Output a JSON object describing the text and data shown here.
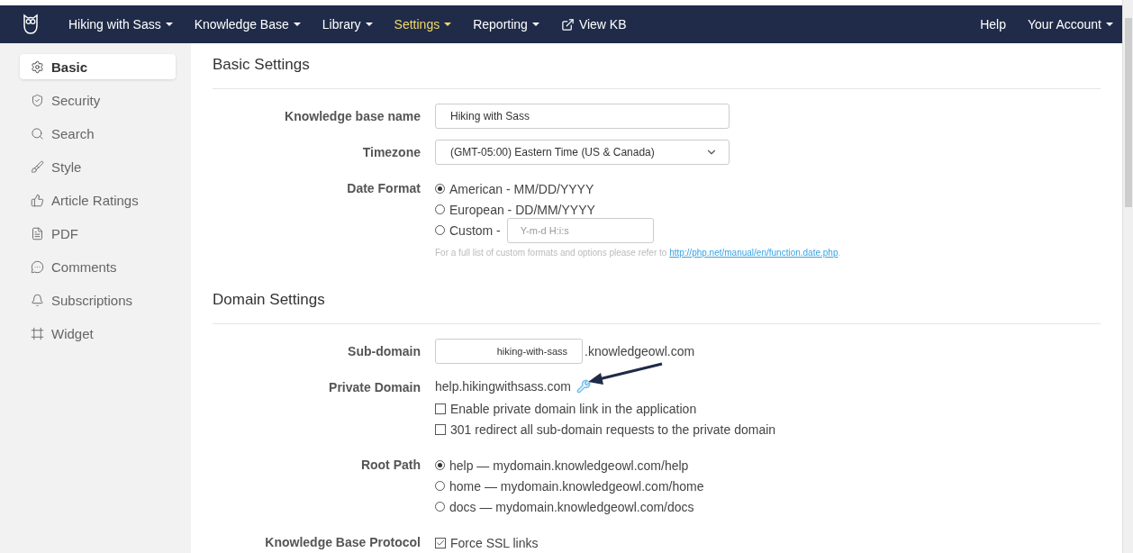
{
  "nav": {
    "items": [
      {
        "label": "Hiking with Sass",
        "dropdown": true,
        "selected": false,
        "kind": "menu"
      },
      {
        "label": "Knowledge Base",
        "dropdown": true,
        "selected": false,
        "kind": "menu"
      },
      {
        "label": "Library",
        "dropdown": true,
        "selected": false,
        "kind": "menu"
      },
      {
        "label": "Settings",
        "dropdown": true,
        "selected": true,
        "kind": "menu"
      },
      {
        "label": "Reporting",
        "dropdown": true,
        "selected": false,
        "kind": "menu"
      },
      {
        "label": "View KB",
        "dropdown": false,
        "selected": false,
        "kind": "external"
      }
    ],
    "right": [
      {
        "label": "Help",
        "dropdown": false
      },
      {
        "label": "Your Account",
        "dropdown": true
      }
    ]
  },
  "sidebar": {
    "items": [
      {
        "label": "Basic",
        "selected": true
      },
      {
        "label": "Security",
        "selected": false
      },
      {
        "label": "Search",
        "selected": false
      },
      {
        "label": "Style",
        "selected": false
      },
      {
        "label": "Article Ratings",
        "selected": false
      },
      {
        "label": "PDF",
        "selected": false
      },
      {
        "label": "Comments",
        "selected": false
      },
      {
        "label": "Subscriptions",
        "selected": false
      },
      {
        "label": "Widget",
        "selected": false
      }
    ]
  },
  "sections": [
    {
      "title": "Basic Settings",
      "rows": [
        {
          "kind": "text",
          "label": "Knowledge base name",
          "value": "Hiking with Sass"
        },
        {
          "kind": "select",
          "label": "Timezone",
          "value": "(GMT-05:00) Eastern Time (US & Canada)"
        },
        {
          "kind": "radios",
          "label": "Date Format",
          "options": [
            {
              "label": "American - MM/DD/YYYY",
              "selected": true
            },
            {
              "label": "European - DD/MM/YYYY",
              "selected": false
            },
            {
              "label": "Custom -",
              "selected": false,
              "placeholder": "Y-m-d H:i:s"
            }
          ],
          "help": "For a full list of custom formats and options please refer to ",
          "link": "http://php.net/manual/en/function.date.php",
          "help_end": "."
        }
      ]
    },
    {
      "title": "Domain Settings",
      "rows": [
        {
          "kind": "subdomain",
          "label": "Sub-domain",
          "value": "hiking-with-sass",
          "suffix": ".knowledgeowl.com"
        },
        {
          "kind": "private",
          "label": "Private Domain",
          "value": "help.hikingwithsass.com",
          "options": [
            {
              "label": "Enable private domain link in the application",
              "checked": false
            },
            {
              "label": "301 redirect all sub-domain requests to the private domain",
              "checked": false
            }
          ]
        },
        {
          "kind": "radios",
          "label": "Root Path",
          "options": [
            {
              "label": "help — mydomain.knowledgeowl.com/help",
              "selected": true
            },
            {
              "label": "home — mydomain.knowledgeowl.com/home",
              "selected": false
            },
            {
              "label": "docs — mydomain.knowledgeowl.com/docs",
              "selected": false
            }
          ]
        },
        {
          "kind": "checks",
          "label": "Knowledge Base Protocol",
          "options": [
            {
              "label": "Force SSL links",
              "checked": true
            }
          ]
        }
      ]
    }
  ]
}
